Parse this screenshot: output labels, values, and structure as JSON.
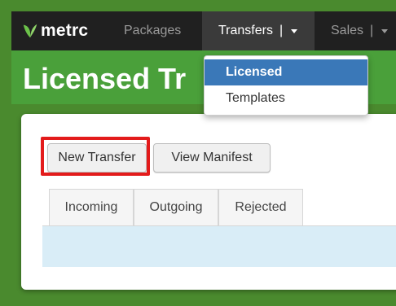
{
  "topbar": {
    "brand": "metrc",
    "nav": [
      {
        "label": "Packages"
      },
      {
        "label": "Transfers",
        "separator": "|"
      },
      {
        "label": "Sales",
        "separator": "|"
      }
    ]
  },
  "header": {
    "title": "Licensed Tr"
  },
  "dropdown": {
    "items": [
      {
        "label": "Licensed",
        "selected": true
      },
      {
        "label": "Templates"
      }
    ]
  },
  "toolbar": {
    "new_transfer_label": "New Transfer",
    "view_manifest_label": "View Manifest"
  },
  "tabs": [
    {
      "label": "Incoming"
    },
    {
      "label": "Outgoing"
    },
    {
      "label": "Rejected"
    }
  ],
  "colors": {
    "nav_bg": "#202020",
    "brand_green": "#4aa03a",
    "highlight_red": "#e31b1b",
    "selected_item": "#3a78b8",
    "info_panel": "#d9edf7"
  },
  "icons": {
    "logo": "metrc-leaf-icon",
    "caret": "caret-down-icon"
  }
}
